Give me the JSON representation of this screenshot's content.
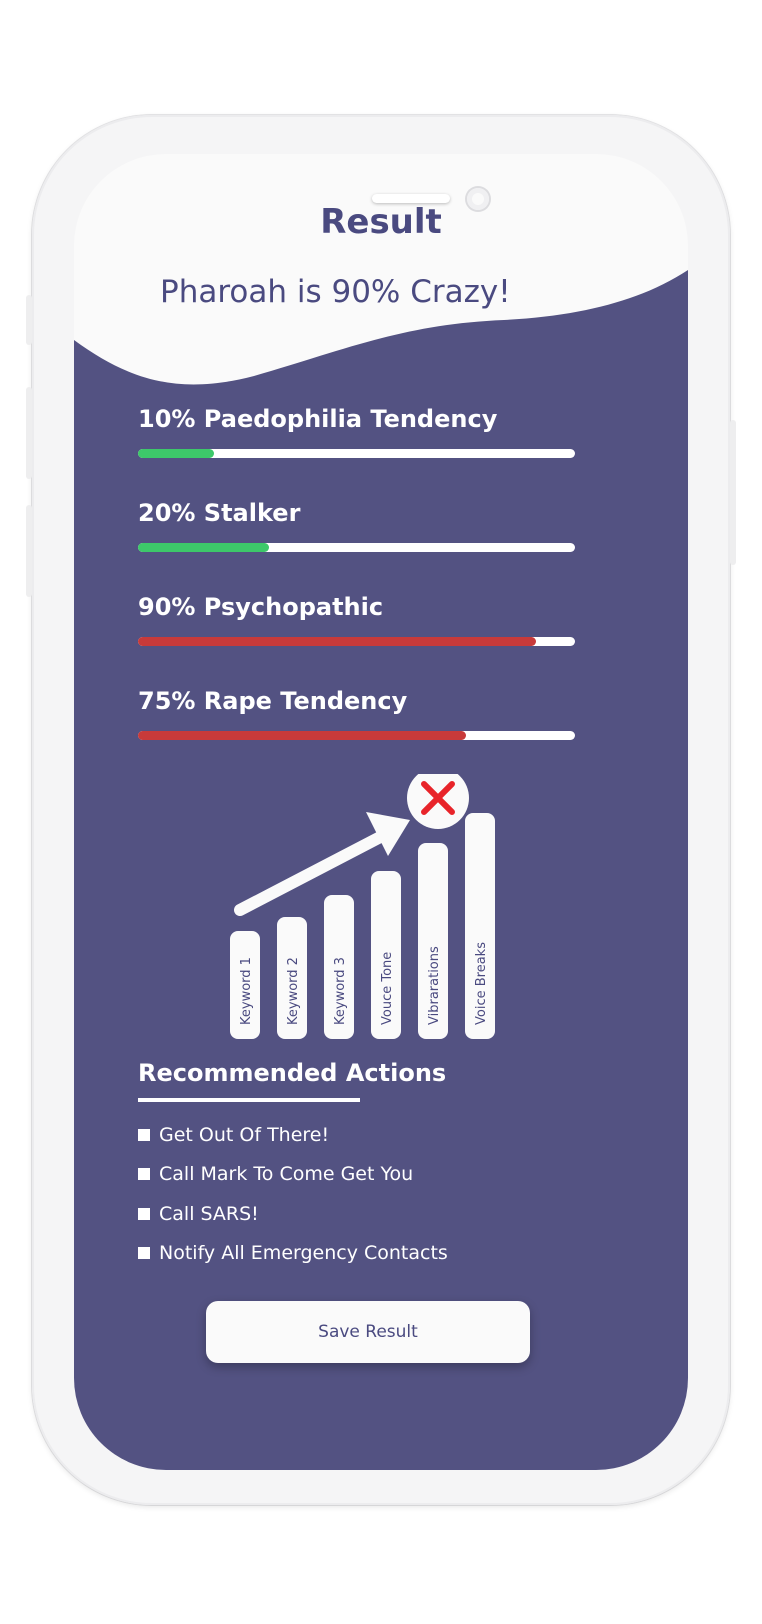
{
  "screen": {
    "title": "Result",
    "headline": "Pharoah is 90% Crazy!"
  },
  "colors": {
    "panel": "#535282",
    "text_purple": "#4a4a80",
    "bar_low": "#3dc86a",
    "bar_high": "#c83a3a",
    "track": "#ffffff",
    "close_x": "#e8242a"
  },
  "metrics": [
    {
      "label": "10% Paedophilia Tendency",
      "percent": 17.5,
      "level": "low"
    },
    {
      "label": "20% Stalker",
      "percent": 30,
      "level": "low"
    },
    {
      "label": "90% Psychopathic",
      "percent": 91,
      "level": "high"
    },
    {
      "label": "75% Rape Tendency",
      "percent": 75,
      "level": "high"
    }
  ],
  "illustration": {
    "bars": [
      "Keyword 1",
      "Keyword 2",
      "Keyword 3",
      "Vouce Tone",
      "Vibrarations",
      "Voice Breaks"
    ],
    "close_icon": "close-x-icon",
    "arrow_icon": "trend-arrow-icon"
  },
  "actions": {
    "title": "Recommended Actions",
    "items": [
      "Get Out Of There!",
      "Call Mark To Come Get You",
      "Call SARS!",
      "Notify All Emergency Contacts"
    ]
  },
  "save_button": {
    "label": "Save Result"
  }
}
